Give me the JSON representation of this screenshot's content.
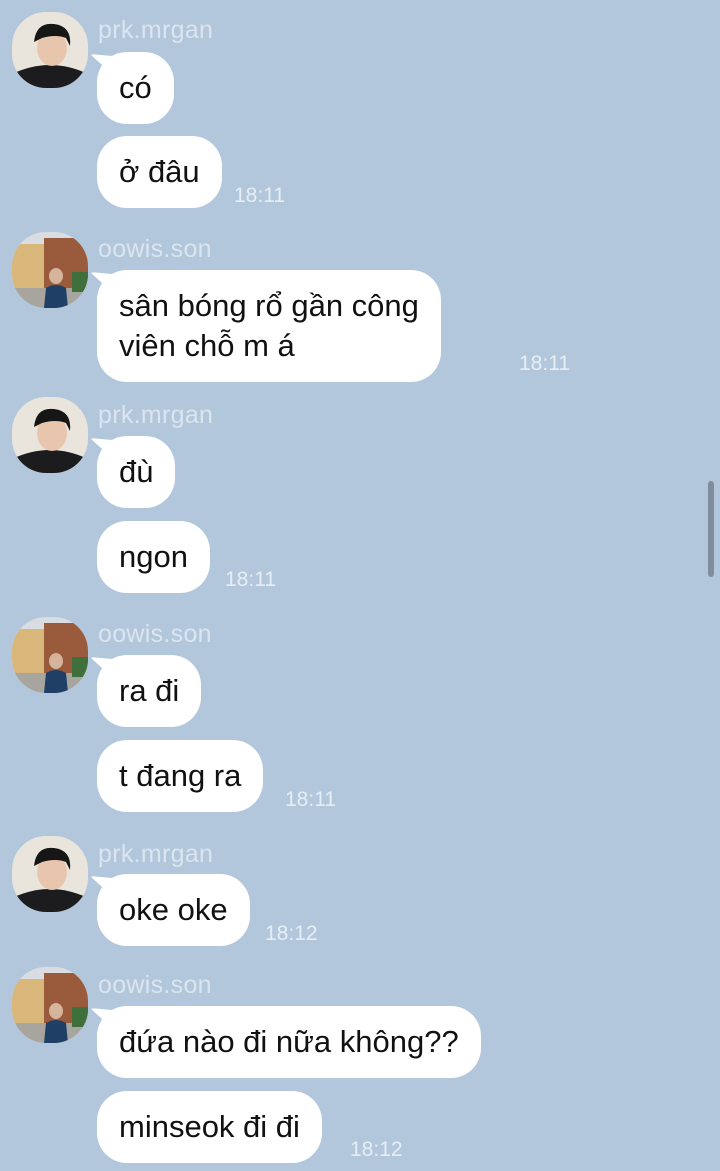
{
  "colors": {
    "background": "#b3c7dc",
    "bubble": "#ffffff",
    "sender_text": "#dbe5ef",
    "time_text": "#e6eef5"
  },
  "users": {
    "prk": {
      "name": "prk.mrgan",
      "avatar_icon": "user-avatar-icon"
    },
    "son": {
      "name": "oowis.son",
      "avatar_icon": "user-avatar-icon"
    }
  },
  "groups": [
    {
      "sender": "prk.mrgan",
      "messages": [
        "có",
        "ở đâu"
      ],
      "time": "18:11"
    },
    {
      "sender": "oowis.son",
      "messages": [
        "sân bóng rổ gần công\nviên chỗ m á"
      ],
      "time": "18:11"
    },
    {
      "sender": "prk.mrgan",
      "messages": [
        "đù",
        "ngon"
      ],
      "time": "18:11"
    },
    {
      "sender": "oowis.son",
      "messages": [
        "ra đi",
        "t đang ra"
      ],
      "time": "18:11"
    },
    {
      "sender": "prk.mrgan",
      "messages": [
        "oke oke"
      ],
      "time": "18:12"
    },
    {
      "sender": "oowis.son",
      "messages": [
        "đứa nào đi nữa không??",
        "minseok đi đi"
      ],
      "time": "18:12"
    }
  ]
}
